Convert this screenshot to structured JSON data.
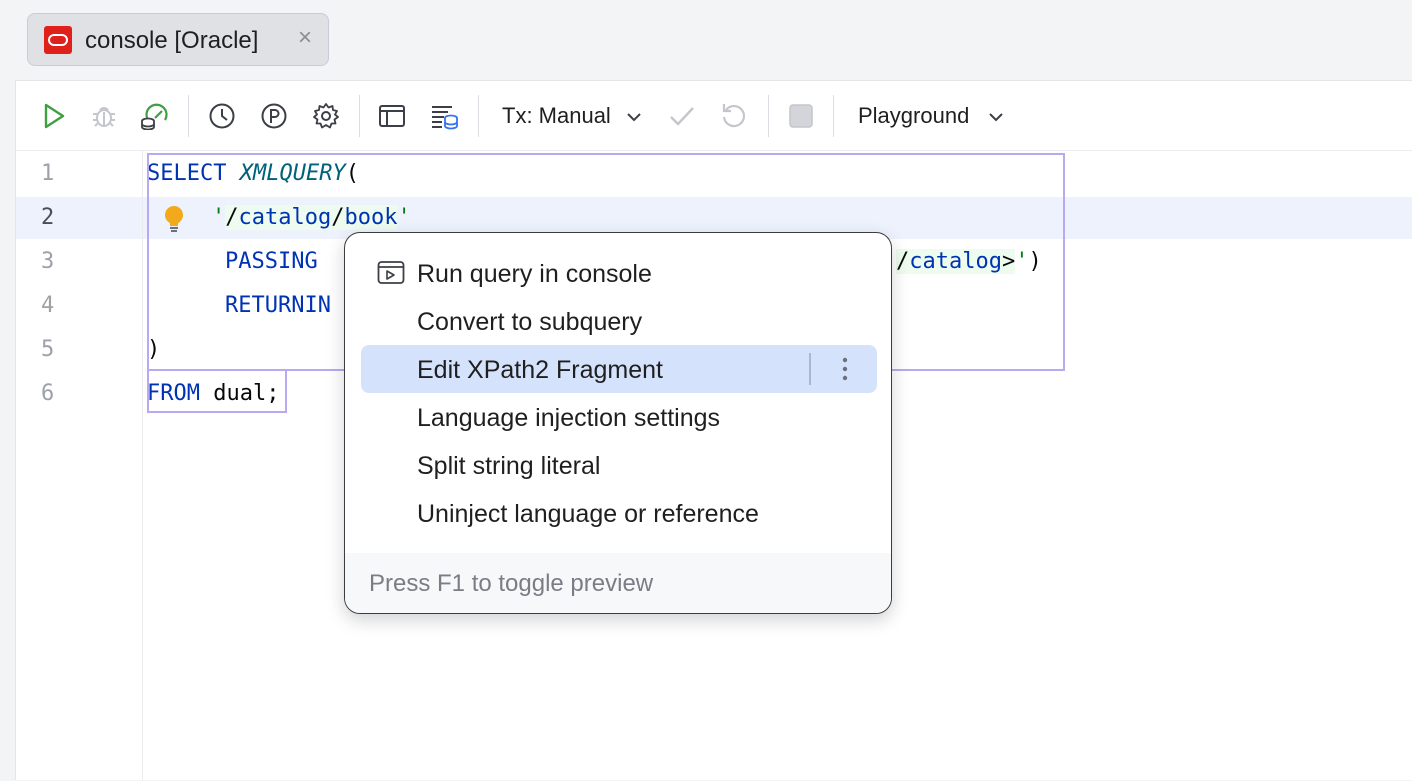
{
  "tab": {
    "title": "console [Oracle]",
    "close": "×",
    "icon": "oracle-icon"
  },
  "toolbar": {
    "tx_label": "Tx: Manual",
    "mode_label": "Playground",
    "icons": [
      "run-icon",
      "debug-icon",
      "explain-plan-icon",
      "history-icon",
      "parameters-icon",
      "settings-icon",
      "layout-icon",
      "output-icon",
      "commit-icon",
      "rollback-icon",
      "stop-icon"
    ],
    "colors": {
      "run": "#3f9f43",
      "explain": "#3f9f43",
      "db_blue": "#3574f0",
      "disabled": "#c4c6cc"
    }
  },
  "editor": {
    "line_numbers": [
      "1",
      "2",
      "3",
      "4",
      "5",
      "6"
    ],
    "lines": {
      "l1_kw": "SELECT",
      "l1_fn": "XMLQUERY",
      "l1_paren": "(",
      "l2_q1": "'",
      "l2_s1": "/",
      "l2_t1": "catalog",
      "l2_s2": "/",
      "l2_t2": "book",
      "l2_q2": "'",
      "l3_kw": "PASSING",
      "l3_s1": "/",
      "l3_t1": "catalog",
      "l3_s2": ">",
      "l3_q": "'",
      "l3_paren": ")",
      "l4_kw": "RETURNIN",
      "l5": ")",
      "l6_kw": "FROM",
      "l6_rest": " dual;"
    },
    "colors": {
      "keyword": "#0033b3",
      "function": "#00627a",
      "string": "#067d17",
      "injection_bg": "#edfcee",
      "frame": "#b8a9f0"
    }
  },
  "popup": {
    "items": [
      {
        "label": "Run query in console",
        "icon": "console-run-icon"
      },
      {
        "label": "Convert to subquery"
      },
      {
        "label": "Edit XPath2 Fragment",
        "selected": true
      },
      {
        "label": "Language injection settings"
      },
      {
        "label": "Split string literal"
      },
      {
        "label": "Uninject language or reference"
      }
    ],
    "footer": "Press F1 to toggle preview",
    "selected_color": "#d4e2fb"
  }
}
